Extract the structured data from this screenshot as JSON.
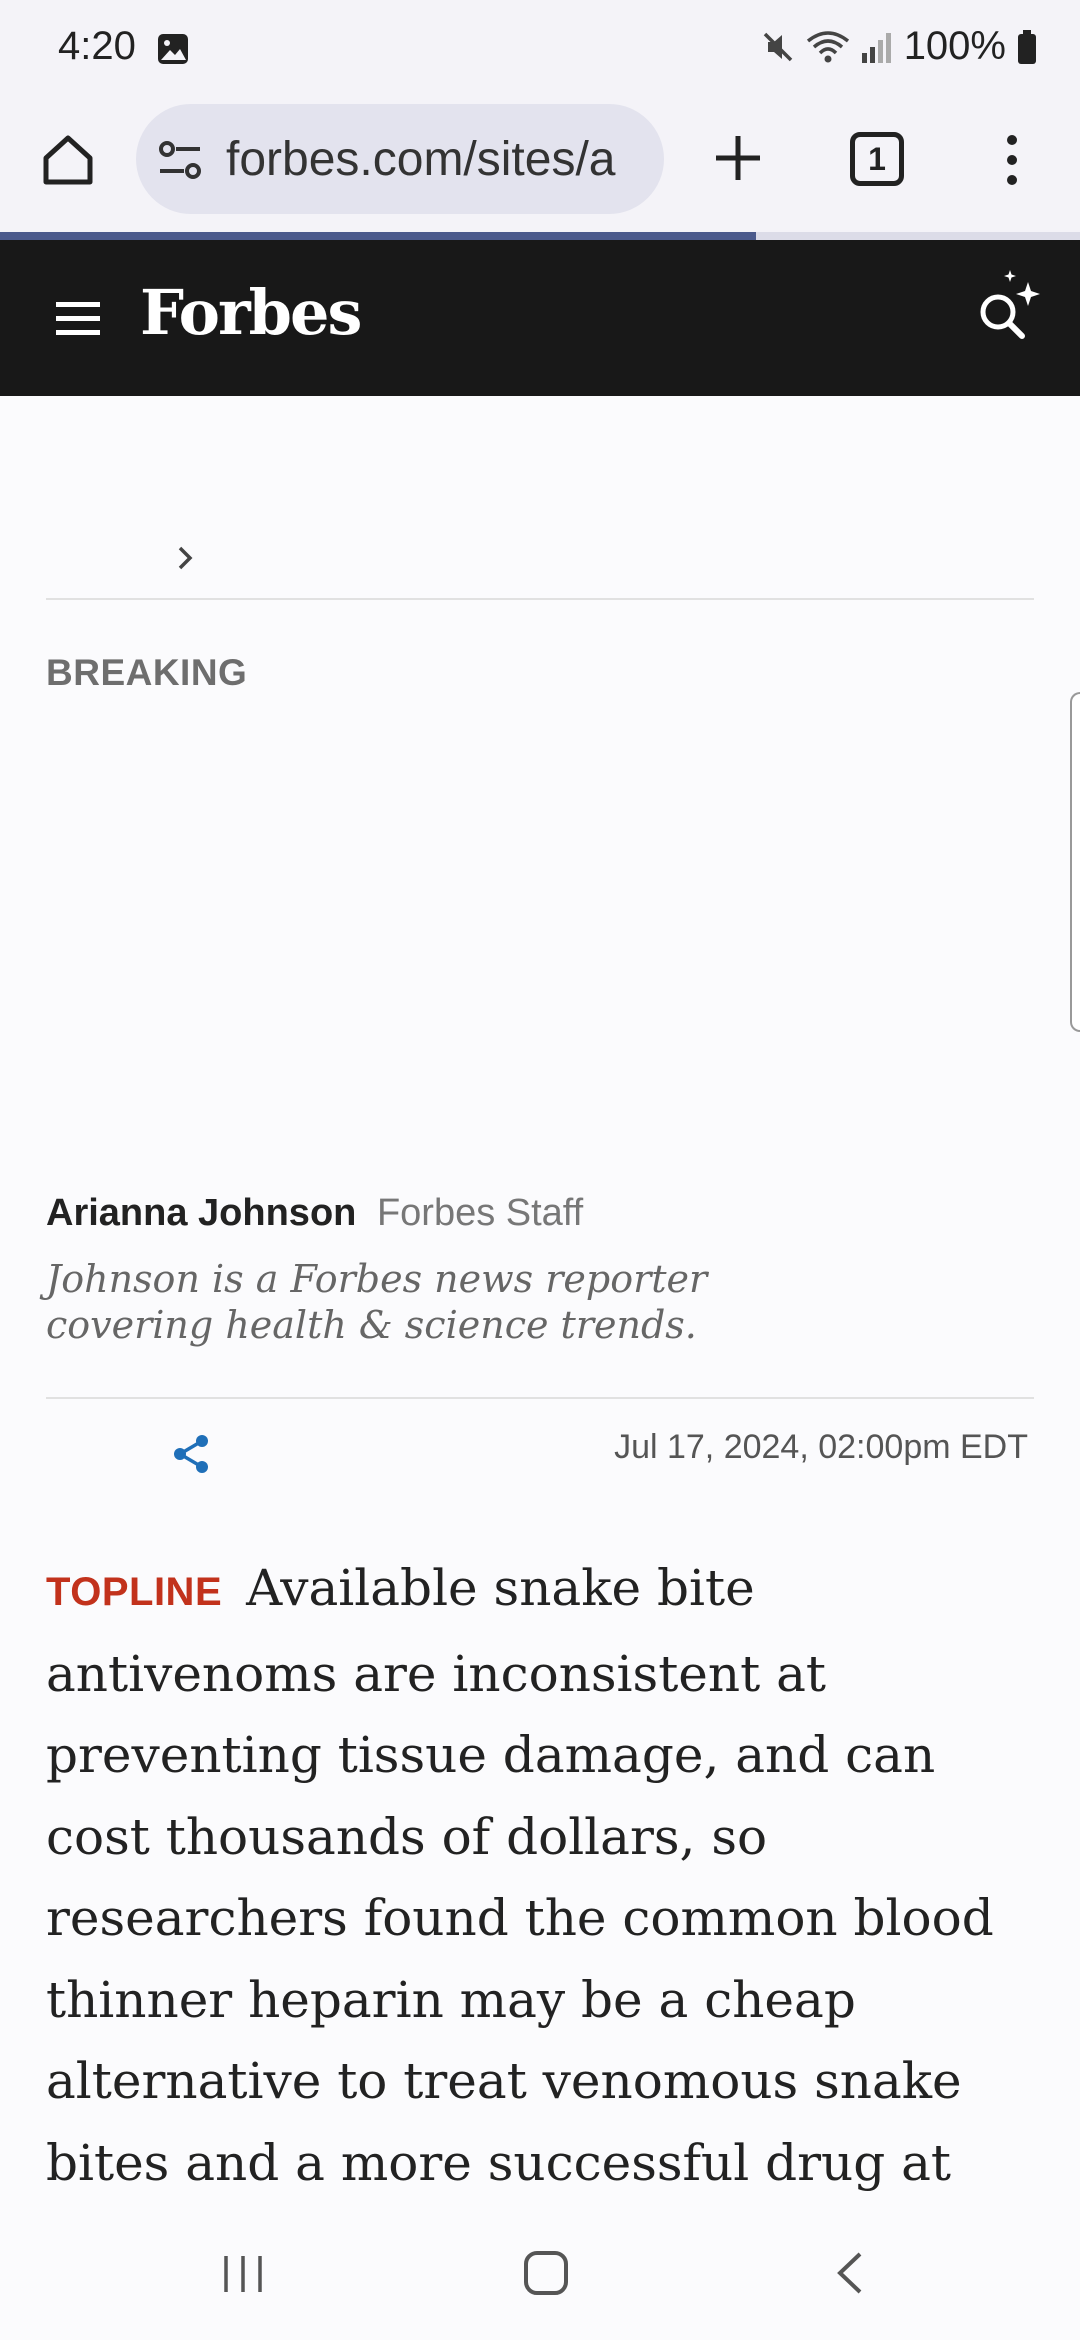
{
  "status_bar": {
    "time": "4:20",
    "battery": "100%",
    "icons": [
      "image-icon",
      "mute-icon",
      "wifi-icon",
      "signal-icon",
      "battery-icon"
    ]
  },
  "browser": {
    "url": "forbes.com/sites/a",
    "tab_count": "1",
    "load_progress": 0.7,
    "accent": "#4b5a8c"
  },
  "site": {
    "logo": "Forbes",
    "header_bg": "#181818"
  },
  "article": {
    "kicker": "BREAKING",
    "author_name": "Arianna Johnson",
    "author_role": "Forbes Staff",
    "author_bio": "Johnson is a Forbes news reporter covering health & science trends.",
    "date": "Jul 17, 2024,",
    "time": "02:00pm EDT",
    "topline_label": "TOPLINE",
    "topline_text": "Available snake bite antivenoms are inconsistent at preventing tissue damage, and can cost thousands of dollars, so researchers found the common blood thinner heparin may be a cheap alternative to treat venomous snake bites and a more successful drug at preventing amputation.",
    "topline_color": "#c2321c"
  }
}
